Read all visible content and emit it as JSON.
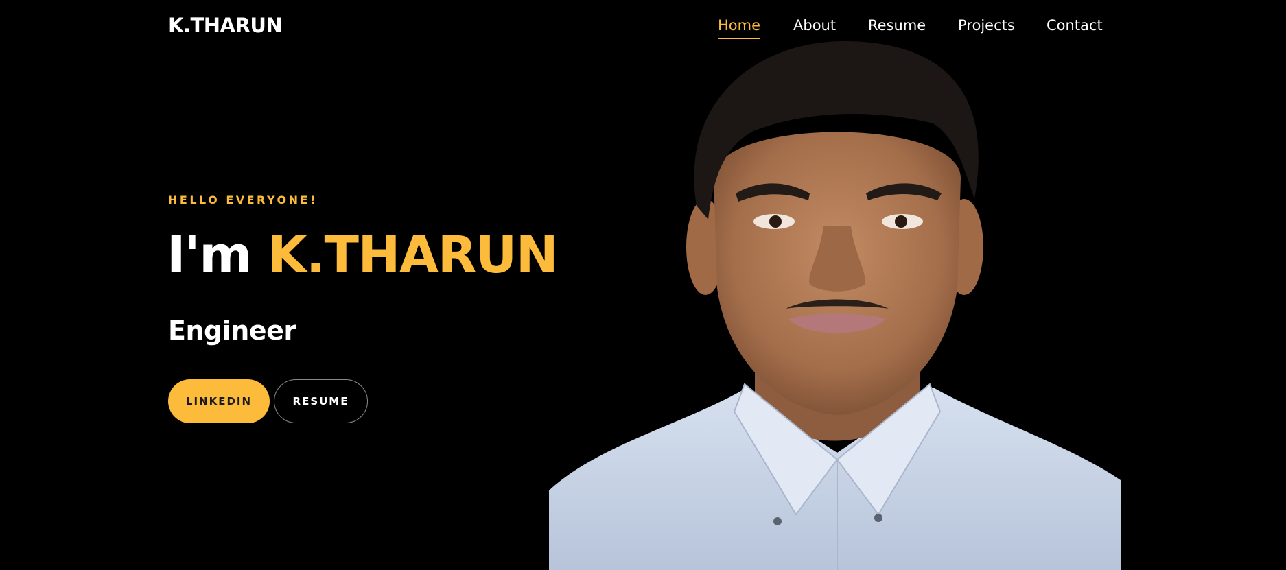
{
  "header": {
    "logo": "K.THARUN",
    "nav": [
      {
        "label": "Home",
        "active": true
      },
      {
        "label": "About",
        "active": false
      },
      {
        "label": "Resume",
        "active": false
      },
      {
        "label": "Projects",
        "active": false
      },
      {
        "label": "Contact",
        "active": false
      }
    ]
  },
  "hero": {
    "greeting": "HELLO EVERYONE!",
    "intro": "I'm",
    "name": "K.THARUN",
    "role": "Engineer",
    "buttons": {
      "linkedin": "LINKEDIN",
      "resume": "RESUME"
    }
  },
  "colors": {
    "background": "#000000",
    "accent": "#fdbb3b",
    "text": "#ffffff",
    "shirt": "#c9d5e8",
    "skin": "#b07a55",
    "hair": "#1c1714"
  }
}
